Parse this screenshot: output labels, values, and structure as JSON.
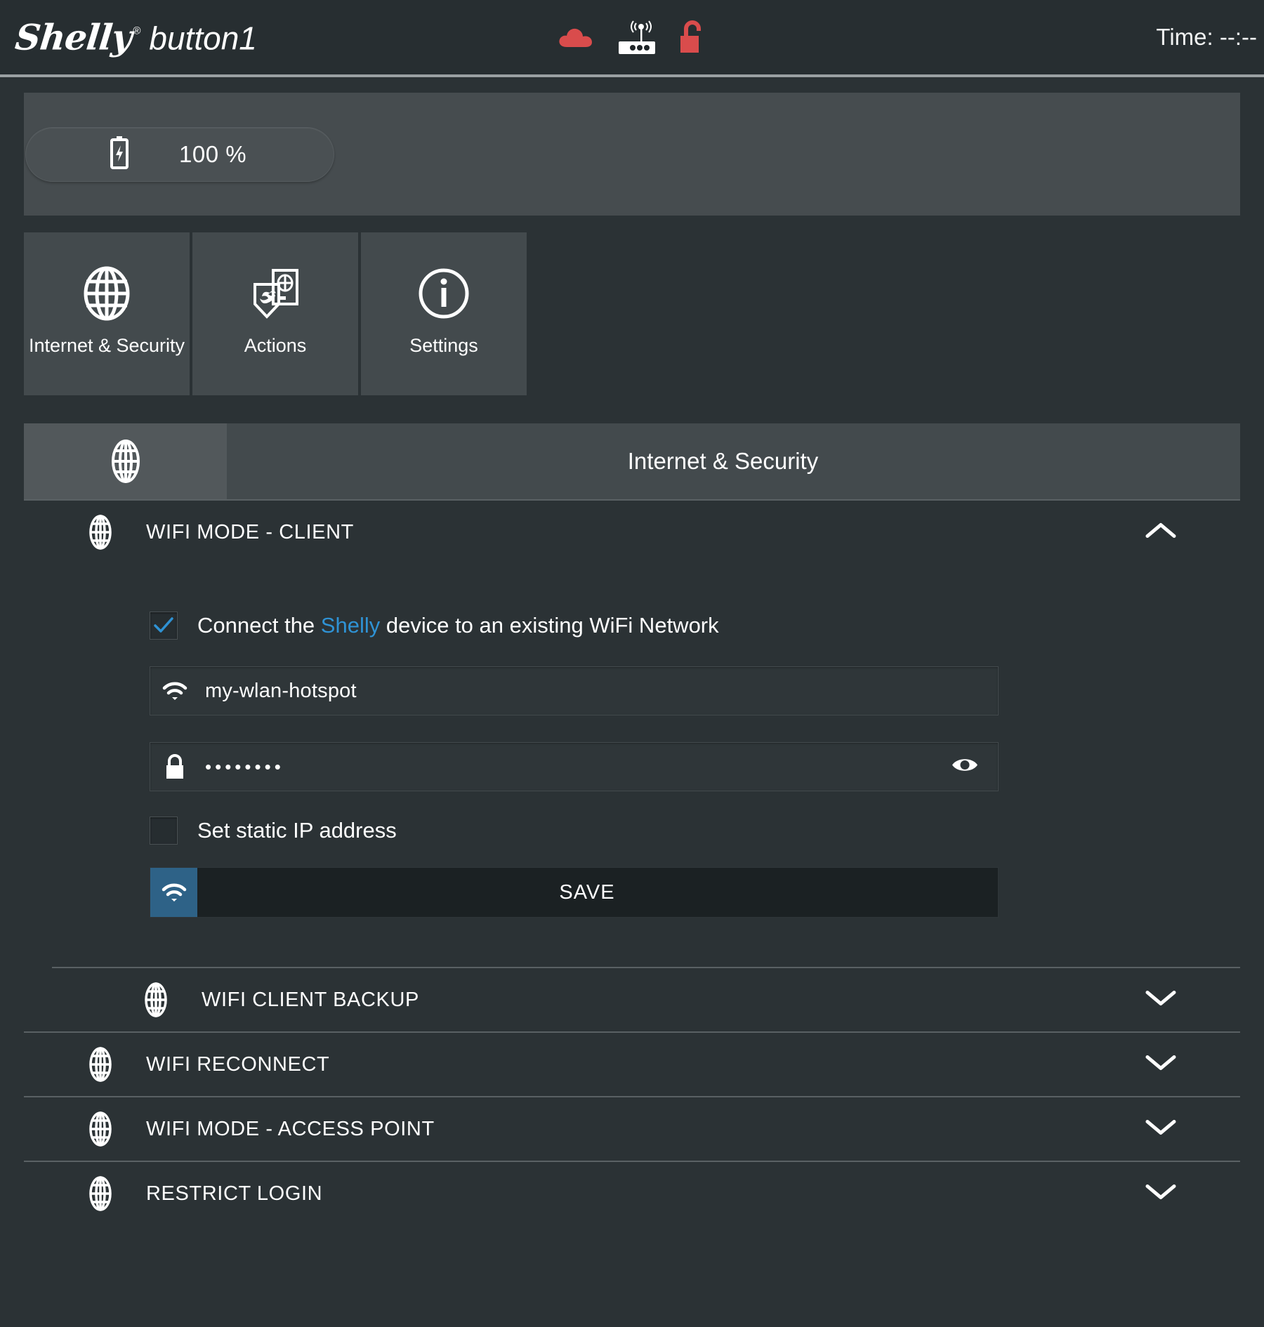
{
  "header": {
    "brand": "Shelly",
    "brand_reg": "®",
    "model": "button1",
    "time_label": "Time: --:--",
    "icons": {
      "cloud": "cloud-icon",
      "router": "router-icon",
      "lock": "unlocked-padlock-icon"
    },
    "colors": {
      "cloud": "#d94c4c",
      "lock": "#d94c4c",
      "router": "#ffffff"
    }
  },
  "battery": {
    "icon": "battery-charging-icon",
    "percent": "100 %"
  },
  "tabs": [
    {
      "label": "Internet & Security",
      "icon": "globe-icon"
    },
    {
      "label": "Actions",
      "icon": "device-actions-icon"
    },
    {
      "label": "Settings",
      "icon": "info-circle-icon"
    }
  ],
  "section": {
    "icon": "globe-icon",
    "title": "Internet & Security"
  },
  "wifi_client": {
    "title": "WIFI MODE - CLIENT",
    "icon": "globe-icon",
    "chevron": "chevron-up-icon",
    "connect_checkbox": {
      "checked": true,
      "text_before": "Connect the ",
      "accent": "Shelly",
      "text_after": " device to an existing WiFi Network",
      "accent_color": "#2f92d4"
    },
    "ssid": {
      "icon": "wifi-icon",
      "value": "my-wlan-hotspot",
      "placeholder": "SSID"
    },
    "password": {
      "icon": "lock-icon",
      "value": "••••••••",
      "placeholder": "Password",
      "reveal_icon": "eye-icon"
    },
    "static_ip": {
      "checked": false,
      "label": "Set static IP address"
    },
    "save": {
      "label": "SAVE",
      "icon": "wifi-icon",
      "icon_bg": "#2e6287"
    }
  },
  "collapsed_rows": [
    {
      "label": "WIFI CLIENT BACKUP",
      "icon": "globe-icon",
      "chevron": "chevron-down-icon",
      "indent": true
    },
    {
      "label": "WIFI RECONNECT",
      "icon": "globe-icon",
      "chevron": "chevron-down-icon",
      "indent": false
    },
    {
      "label": "WIFI MODE - ACCESS POINT",
      "icon": "globe-icon",
      "chevron": "chevron-down-icon",
      "indent": false
    },
    {
      "label": "RESTRICT LOGIN",
      "icon": "globe-icon",
      "chevron": "chevron-down-icon",
      "indent": false
    }
  ]
}
